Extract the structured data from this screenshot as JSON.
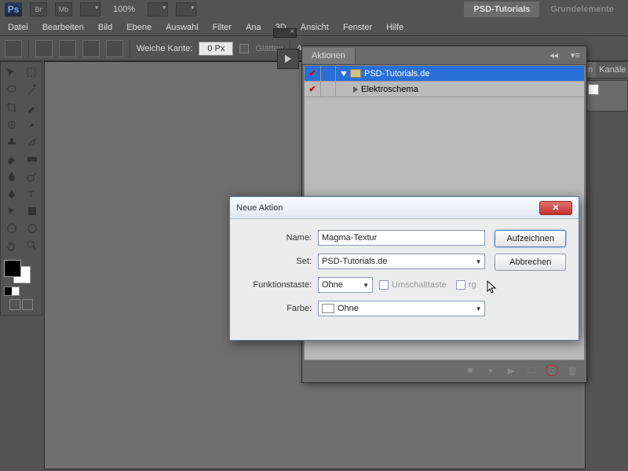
{
  "header": {
    "logo": "Ps",
    "br_label": "Br",
    "mb_label": "Mb",
    "zoom": "100%",
    "project_active": "PSD-Tutorials",
    "project_inactive": "Grundelemente"
  },
  "menu": {
    "file": "Datei",
    "edit": "Bearbeiten",
    "image": "Bild",
    "layer": "Ebene",
    "select": "Auswahl",
    "filter": "Filter",
    "analysis": "Ana",
    "threeD": "3D",
    "view": "Ansicht",
    "window": "Fenster",
    "help": "Hilfe"
  },
  "options": {
    "feather_label": "Weiche Kante:",
    "feather_value": "0 Px",
    "antialias_label": "Glätten",
    "trailing": "A"
  },
  "right_panel": {
    "tab_n": "n",
    "tab_channels": "Kanäle"
  },
  "actions_panel": {
    "tab_label": "Aktionen",
    "set_name": "PSD-Tutorials.de",
    "action_name": "Elektroschema"
  },
  "dialog": {
    "title": "Neue Aktion",
    "name_label": "Name:",
    "name_value": "Magma-Textur",
    "set_label": "Set:",
    "set_value": "PSD-Tutorials.de",
    "fkey_label": "Funktionstaste:",
    "fkey_value": "Ohne",
    "shift_label": "Umschalttaste",
    "ctrl_label": "rg",
    "color_label": "Farbe:",
    "color_value": "Ohne",
    "btn_record": "Aufzeichnen",
    "btn_cancel": "Abbrechen"
  }
}
